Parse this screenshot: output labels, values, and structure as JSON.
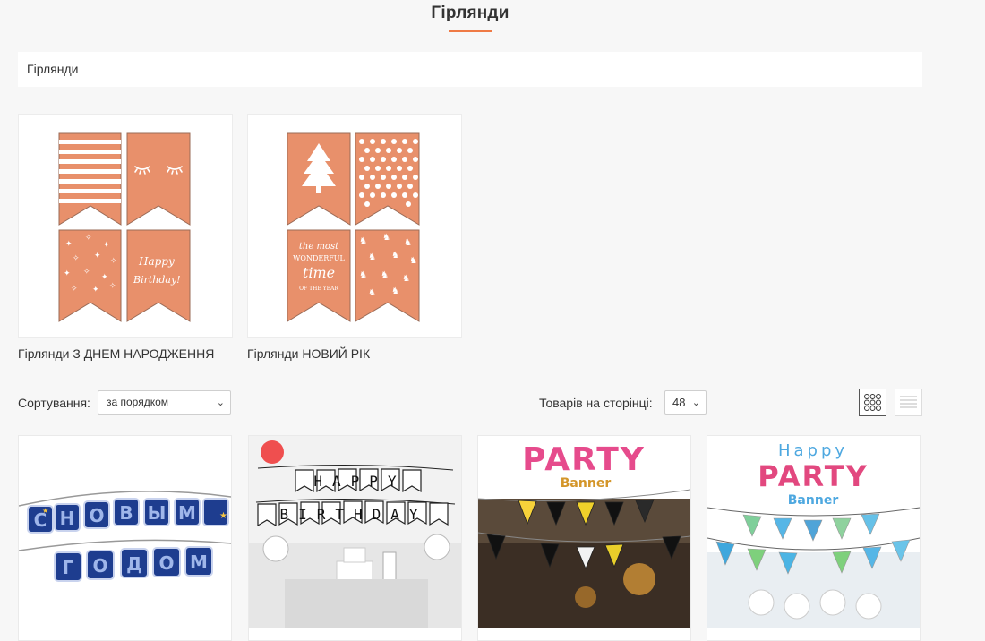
{
  "page": {
    "title": "Гірлянди",
    "description": "Гірлянди"
  },
  "subcategories": [
    {
      "name": "Гірлянди З ДНЕМ НАРОДЖЕННЯ",
      "flag_text": "Happy Birthday!"
    },
    {
      "name": "Гірлянди НОВИЙ РІК",
      "flag_text": [
        "the most",
        "wonderful",
        "time",
        "OF THE YEAR"
      ]
    }
  ],
  "toolbar": {
    "sort_label": "Сортування:",
    "sort_value": "за порядком",
    "per_page_label": "Товарів на сторінці:",
    "per_page_value": "48",
    "view_modes": [
      "grid-view",
      "list-view"
    ]
  },
  "products": [
    {
      "image_text": [
        "С",
        "Н",
        "О",
        "В",
        "Ы",
        "М",
        "Г",
        "О",
        "Д",
        "О",
        "М"
      ]
    },
    {
      "image_text": [
        "HAPPY",
        "BIRTHDAY"
      ]
    },
    {
      "image_text": [
        "PARTY",
        "Banner"
      ]
    },
    {
      "image_text": [
        "Happy",
        "PARTY",
        "Banner"
      ]
    }
  ],
  "colors": {
    "accent": "#ef7a45",
    "flag": "#e8906b",
    "navy": "#1e3d8f"
  }
}
